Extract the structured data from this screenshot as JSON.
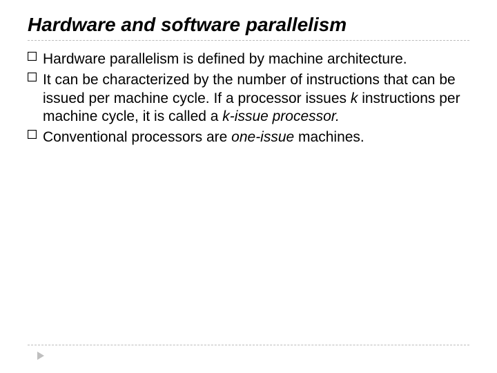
{
  "title": "Hardware and software parallelism",
  "bullets": [
    {
      "pre": "Hardware",
      "post": " parallelism is defined by machine architecture."
    },
    {
      "pre": "It",
      "post_a": " can be characterized by the number of instructions that can be issued per machine cycle. If a processor issues ",
      "k": "k",
      "post_b": " instructions per machine cycle, it is called a ",
      "term": "k-issue processor.",
      "post_c": ""
    },
    {
      "pre": "Conventional",
      "post_a": " processors are ",
      "term": "one-issue",
      "post_b": " machines."
    }
  ]
}
